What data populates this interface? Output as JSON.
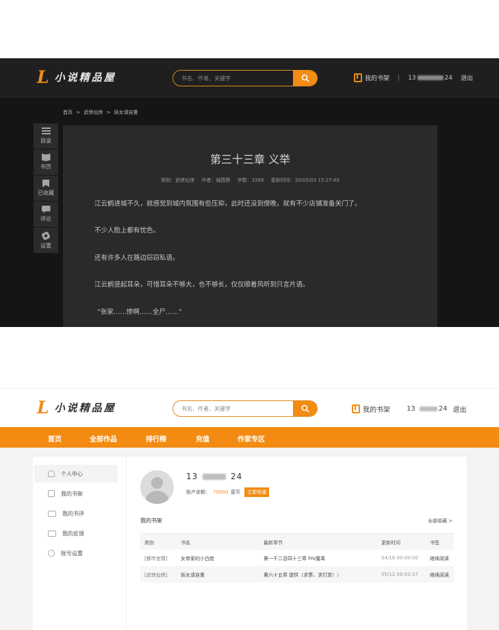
{
  "brand": {
    "mark": "L",
    "name": "小说精品屋",
    "accent": "#f28c12"
  },
  "reader": {
    "search_placeholder": "书名、作者、关键字",
    "shelf_label": "我的书架",
    "user_prefix": "13",
    "user_suffix": "24",
    "logout": "退出",
    "breadcrumb": [
      "首页",
      ">",
      "武侠仙侠",
      ">",
      "妖女请自重"
    ],
    "sidebar": [
      {
        "label": "目录",
        "icon": "list-icon"
      },
      {
        "label": "书页",
        "icon": "book-icon"
      },
      {
        "label": "已收藏",
        "icon": "bookmark-icon"
      },
      {
        "label": "评论",
        "icon": "comment-icon"
      },
      {
        "label": "设置",
        "icon": "gear-icon"
      }
    ],
    "chapter_title": "第三十三章 义举",
    "meta": {
      "category": "类别：武侠仙侠",
      "author": "作者：袖图斋",
      "words": "字数：3268",
      "updated": "更新时间：20/05/03 15:27:40"
    },
    "paragraphs": [
      "江云鹤进城不久，就感觉到城内氛围有些压抑，此时还没到傍晚，就有不少店铺准备关门了。",
      "不少人脸上都有忧色。",
      "还有许多人在路边窃窃私语。",
      "江云鹤竖起耳朵，可惜耳朵不够大，也不够长，仅仅顺着风听到只言片语。",
      "“张家……惨啊……全尸……”"
    ]
  },
  "usercenter": {
    "search_placeholder": "书名、作者、关键字",
    "shelf_label": "我的书架",
    "user_prefix": "13",
    "user_suffix": "24",
    "logout": "退出",
    "nav": [
      "首页",
      "全部作品",
      "排行榜",
      "充值",
      "作家专区"
    ],
    "side": [
      "个人中心",
      "我的书架",
      "我的书评",
      "我的反馈",
      "账号设置"
    ],
    "username_prefix": "13",
    "username_suffix": "24",
    "balance_label": "账户余额：",
    "balance_amount": "79000",
    "balance_unit": "屋币",
    "recharge": "立即充值",
    "shelf_title": "我的书架",
    "all_fav": "全部收藏 >",
    "table": {
      "headers": [
        "类别",
        "书名",
        "最新章节",
        "更新时间",
        "书签"
      ],
      "rows": [
        [
          "[都市言情]",
          "女帝家的小白脸",
          "第一千二百四十三章 FIV魔毒",
          "04/16 00:00:00",
          "继续阅读"
        ],
        [
          "[武侠仙侠]",
          "妖女请自重",
          "第六十五章 提供（求票、求打赏！）",
          "05/12 06:03:37",
          "继续阅读"
        ]
      ]
    }
  }
}
